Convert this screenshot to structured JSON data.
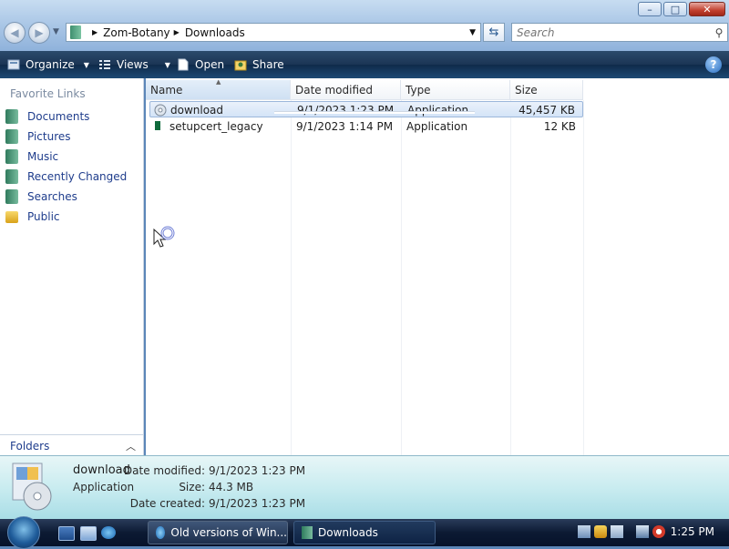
{
  "address_bar": {
    "breadcrumbs": [
      "Zom-Botany",
      "Downloads"
    ],
    "search_placeholder": "Search"
  },
  "window_controls": {
    "minimize": "–",
    "maximize": "□",
    "close": "✕"
  },
  "toolbar": {
    "organize": "Organize",
    "views": "Views",
    "open": "Open",
    "share": "Share",
    "help": "?"
  },
  "nav_pane": {
    "title": "Favorite Links",
    "items": [
      {
        "label": "Documents",
        "icon": "documents-icon"
      },
      {
        "label": "Pictures",
        "icon": "pictures-icon"
      },
      {
        "label": "Music",
        "icon": "music-icon"
      },
      {
        "label": "Recently Changed",
        "icon": "recent-icon"
      },
      {
        "label": "Searches",
        "icon": "searches-icon"
      },
      {
        "label": "Public",
        "icon": "folder-icon"
      }
    ],
    "folders_label": "Folders"
  },
  "file_list": {
    "columns": [
      "Name",
      "Date modified",
      "Type",
      "Size"
    ],
    "rows": [
      {
        "name": "download",
        "date": "9/1/2023 1:23 PM",
        "type": "Application",
        "size": "45,457 KB",
        "selected": true
      },
      {
        "name": "setupcert_legacy",
        "date": "9/1/2023 1:14 PM",
        "type": "Application",
        "size": "12 KB",
        "selected": false
      }
    ]
  },
  "details": {
    "name": "download",
    "type": "Application",
    "date_modified_label": "Date modified:",
    "date_modified": "9/1/2023 1:23 PM",
    "size_label": "Size:",
    "size": "44.3 MB",
    "date_created_label": "Date created:",
    "date_created": "9/1/2023 1:23 PM"
  },
  "taskbar": {
    "tasks": [
      {
        "label": "Old versions of Win...",
        "icon": "ie-icon"
      },
      {
        "label": "Downloads",
        "icon": "explorer-icon"
      }
    ],
    "clock": "1:25 PM"
  },
  "colors": {
    "link": "#1f3d8c",
    "selection": "#d4e4f7",
    "details_pane": "#c9ecf0",
    "toolbar_bg": "#1b3555"
  }
}
